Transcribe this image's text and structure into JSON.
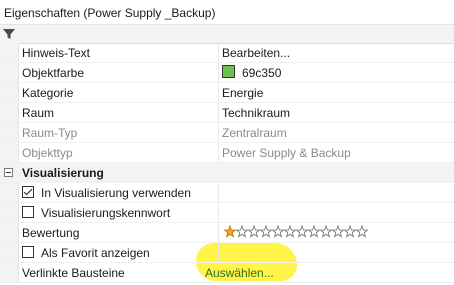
{
  "window": {
    "title": "Eigenschaften (Power Supply _Backup)"
  },
  "toolbar": {
    "filter_icon": "filter-icon"
  },
  "properties": {
    "hinweis_text": {
      "label": "Hinweis-Text",
      "value": "Bearbeiten..."
    },
    "objektfarbe": {
      "label": "Objektfarbe",
      "value": "69c350",
      "color": "#69c350"
    },
    "kategorie": {
      "label": "Kategorie",
      "value": "Energie"
    },
    "raum": {
      "label": "Raum",
      "value": "Technikraum"
    },
    "raum_typ": {
      "label": "Raum-Typ",
      "value": "Zentralraum"
    },
    "objekttyp": {
      "label": "Objekttyp",
      "value": "Power Supply & Backup"
    }
  },
  "visualisierung": {
    "section_label": "Visualisierung",
    "in_visualisierung": {
      "label": "In Visualisierung verwenden",
      "checked": true
    },
    "kennwort": {
      "label": "Visualisierungskennwort",
      "checked": false
    },
    "bewertung": {
      "label": "Bewertung",
      "rating": 1,
      "max": 12,
      "filled_color": "#f5a623"
    },
    "favorit": {
      "label": "Als Favorit anzeigen",
      "checked": false
    },
    "bausteine": {
      "label": "Verlinkte Bausteine",
      "value": "Auswählen..."
    }
  },
  "colors": {
    "highlight": "#fff33d",
    "link": "#2f6d26"
  }
}
